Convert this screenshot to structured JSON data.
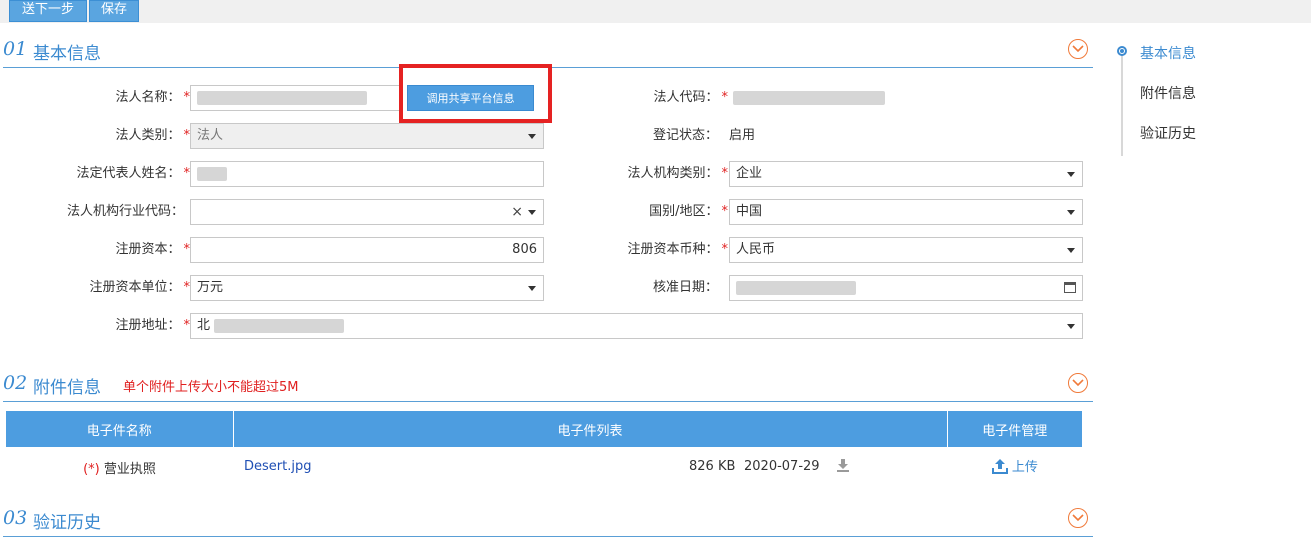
{
  "toolbar": {
    "next_label": "送下一步",
    "save_label": "保存"
  },
  "sections": {
    "basic": {
      "num": "01",
      "title": "基本信息"
    },
    "attach": {
      "num": "02",
      "title": "附件信息",
      "note": "单个附件上传大小不能超过5M"
    },
    "history": {
      "num": "03",
      "title": "验证历史"
    }
  },
  "form": {
    "legal_name": {
      "label": "法人名称：",
      "value": ""
    },
    "share_button": "调用共享平台信息",
    "legal_code": {
      "label": "法人代码：",
      "value": ""
    },
    "legal_type": {
      "label": "法人类别：",
      "value": "法人"
    },
    "reg_status": {
      "label": "登记状态：",
      "value": "启用"
    },
    "rep_name": {
      "label": "法定代表人姓名：",
      "value": ""
    },
    "org_type": {
      "label": "法人机构类别：",
      "value": "企业"
    },
    "industry_code": {
      "label": "法人机构行业代码：",
      "value": ""
    },
    "country": {
      "label": "国别/地区：",
      "value": "中国"
    },
    "capital": {
      "label": "注册资本：",
      "value": "806"
    },
    "currency": {
      "label": "注册资本币种：",
      "value": "人民币"
    },
    "capital_unit": {
      "label": "注册资本单位：",
      "value": "万元"
    },
    "approve_date": {
      "label": "核准日期：",
      "value": ""
    },
    "address": {
      "label": "注册地址：",
      "value": "北"
    },
    "required_mark": "*"
  },
  "attachments": {
    "headers": [
      "电子件名称",
      "电子件列表",
      "电子件管理"
    ],
    "rows": [
      {
        "required": "(*)",
        "name": "营业执照",
        "file": "Desert.jpg",
        "size": "826 KB",
        "date": "2020-07-29",
        "action": "上传"
      }
    ]
  },
  "nav": {
    "items": [
      "基本信息",
      "附件信息",
      "验证历史"
    ]
  },
  "colors": {
    "accent": "#3b8ad0",
    "required": "#e02020",
    "highlight": "#e52222",
    "collapse": "#f07a3a"
  }
}
